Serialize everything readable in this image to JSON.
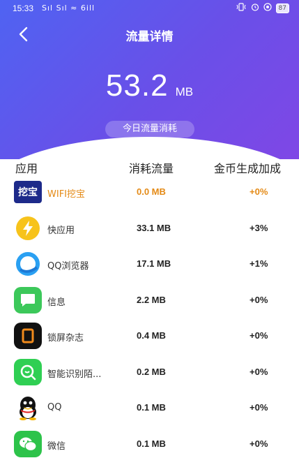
{
  "status_bar": {
    "time": "15:33",
    "signal": "Sıl Sıl ≈ 6ill",
    "battery": "87"
  },
  "header": {
    "title": "流量详情",
    "total_value": "53.2",
    "total_unit": "MB",
    "today_label": "今日流量消耗"
  },
  "table": {
    "headers": {
      "app": "应用",
      "usage": "消耗流量",
      "bonus": "金币生成加成"
    },
    "rows": [
      {
        "name": "WIFI挖宝",
        "usage": "0.0 MB",
        "bonus": "+0%",
        "icon": "wifi-wabao-icon",
        "icon_text": "挖宝"
      },
      {
        "name": "快应用",
        "usage": "33.1 MB",
        "bonus": "+3%",
        "icon": "quick-app-icon"
      },
      {
        "name": "QQ浏览器",
        "usage": "17.1 MB",
        "bonus": "+1%",
        "icon": "qq-browser-icon"
      },
      {
        "name": "信息",
        "usage": "2.2 MB",
        "bonus": "+0%",
        "icon": "messages-icon"
      },
      {
        "name": "锁屏杂志",
        "usage": "0.4 MB",
        "bonus": "+0%",
        "icon": "lockscreen-magazine-icon"
      },
      {
        "name": "智能识别陌...",
        "usage": "0.2 MB",
        "bonus": "+0%",
        "icon": "smart-recognition-icon"
      },
      {
        "name": "QQ",
        "usage": "0.1 MB",
        "bonus": "+0%",
        "icon": "qq-penguin-icon"
      },
      {
        "name": "微信",
        "usage": "0.1 MB",
        "bonus": "+0%",
        "icon": "wechat-icon"
      }
    ]
  },
  "colors": {
    "header_gradient_start": "#4f63f2",
    "header_gradient_end": "#7f47e6",
    "highlight": "#e48a16"
  }
}
